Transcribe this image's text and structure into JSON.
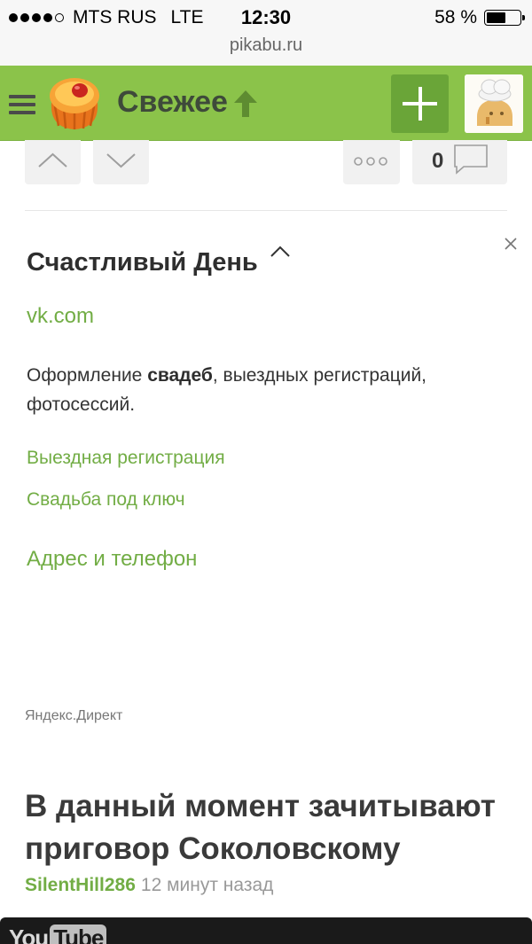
{
  "status_bar": {
    "carrier": "MTS RUS",
    "network": "LTE",
    "time": "12:30",
    "battery_text": "58 %",
    "battery_level": 0.58,
    "signal_filled": 4,
    "signal_total": 5
  },
  "url_bar": {
    "domain": "pikabu.ru"
  },
  "navbar": {
    "title": "Свежее",
    "accent_color": "#8bc34a",
    "icons": [
      "menu-icon",
      "pikabu-logo",
      "arrow-up-icon",
      "plus-icon",
      "avatar"
    ]
  },
  "post_actions": {
    "comment_count": "0",
    "icons": [
      "upvote-icon",
      "downvote-icon",
      "more-dots-icon",
      "comment-icon"
    ]
  },
  "ad": {
    "title": "Счастливый День",
    "domain": "vk.com",
    "description_prefix": "Оформление ",
    "description_bold": "свадеб",
    "description_suffix": ", выездных регистраций, фотосессий.",
    "links": [
      "Выездная регистрация",
      "Свадьба под ключ"
    ],
    "address_link": "Адрес и телефон",
    "source": "Яндекс.Директ",
    "link_color": "#72ad45"
  },
  "post": {
    "title": "В данный момент зачитывают приговор Соколовскому",
    "author": "SilentHill286",
    "time_ago": "12 минут назад"
  },
  "video": {
    "brand_left": "You",
    "brand_right": "Tube"
  }
}
